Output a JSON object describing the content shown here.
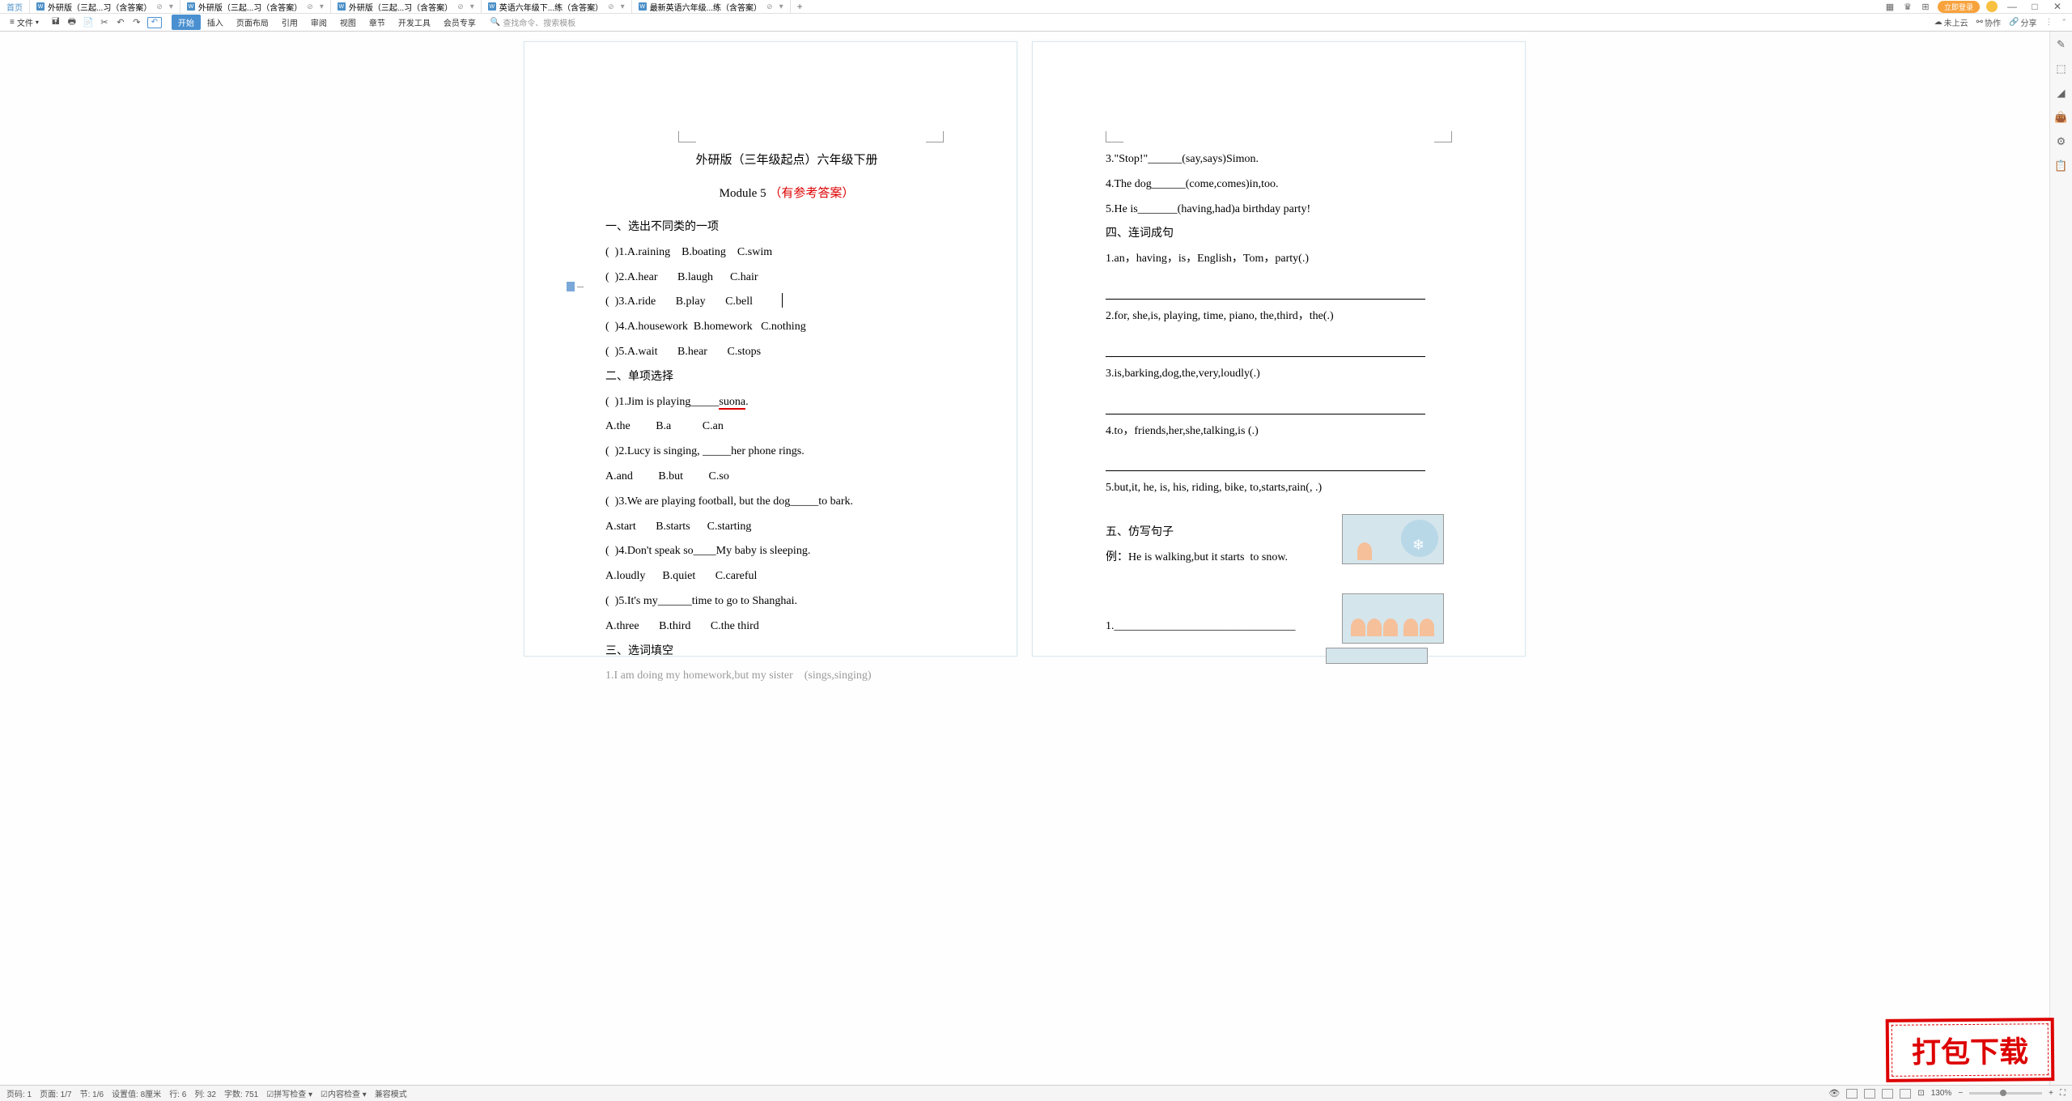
{
  "tabs": {
    "home": "首页",
    "items": [
      {
        "label": "外研版（三起...习（含答案）"
      },
      {
        "label": "外研版（三起...习（含答案）"
      },
      {
        "label": "外研版（三起...习（含答案）"
      },
      {
        "label": "英语六年级下...练（含答案）"
      },
      {
        "label": "最新英语六年级...练（含答案）"
      }
    ]
  },
  "titlebar_right": {
    "login": "立即登录"
  },
  "toolbar": {
    "file": "文件",
    "ribbon": [
      "开始",
      "插入",
      "页面布局",
      "引用",
      "审阅",
      "视图",
      "章节",
      "开发工具",
      "会员专享"
    ],
    "search_placeholder": "查找命令、搜索模板",
    "right": {
      "cloud": "未上云",
      "collab": "协作",
      "share": "分享"
    }
  },
  "document": {
    "title": "外研版（三年级起点）六年级下册",
    "module_prefix": "Module 5",
    "module_red": "（有参考答案）",
    "left_lines": [
      "一、选出不同类的一项",
      "(  )1.A.raining    B.boating    C.swim",
      "(  )2.A.hear       B.laugh      C.hair",
      "(  )3.A.ride       B.play       C.bell",
      "(  )4.A.housework  B.homework   C.nothing",
      "(  )5.A.wait       B.hear       C.stops",
      "二、单项选择",
      "(  )1.Jim is playing_____suona.",
      "A.the         B.a           C.an",
      "(  )2.Lucy is singing, _____her phone rings.",
      "A.and         B.but         C.so",
      "(  )3.We are playing football, but the dog_____to bark.",
      "A.start       B.starts      C.starting",
      "(  )4.Don't speak so____My baby is sleeping.",
      "A.loudly      B.quiet       C.careful",
      "(  )5.It's my______time to go to Shanghai.",
      "A.three       B.third       C.the third",
      "三、选词填空",
      "1.I am doing my homework,but my sister    (sings,singing)"
    ],
    "right_lines": [
      "3.\"Stop!\"______(say,says)Simon.",
      "4.The dog______(come,comes)in,too.",
      "5.He is_______(having,had)a birthday party!",
      "四、连词成句",
      "1.an，having，is，English，Tom，party(.)",
      "",
      "2.for, she,is, playing, time, piano, the,third，the(.)",
      "",
      "3.is,barking,dog,the,very,loudly(.)",
      "",
      "4.to，friends,her,she,talking,is (.)",
      "",
      "5.but,it, he, is, his, riding, bike, to,starts,rain(, .)",
      "",
      "五、仿写句子",
      "例：He is walking,but it starts  to snow.",
      "",
      "",
      "1.________________________________"
    ]
  },
  "stamp": "打包下载",
  "statusbar": {
    "page": "页码: 1",
    "page_pos": "页面: 1/7",
    "section": "节: 1/6",
    "setting": "设置值: 8厘米",
    "line": "行: 6",
    "col": "列: 32",
    "words": "字数: 751",
    "spell": "拼写检查 ▾",
    "content": "内容检查 ▾",
    "compat": "兼容模式",
    "zoom": "130%"
  },
  "chart_data": null
}
